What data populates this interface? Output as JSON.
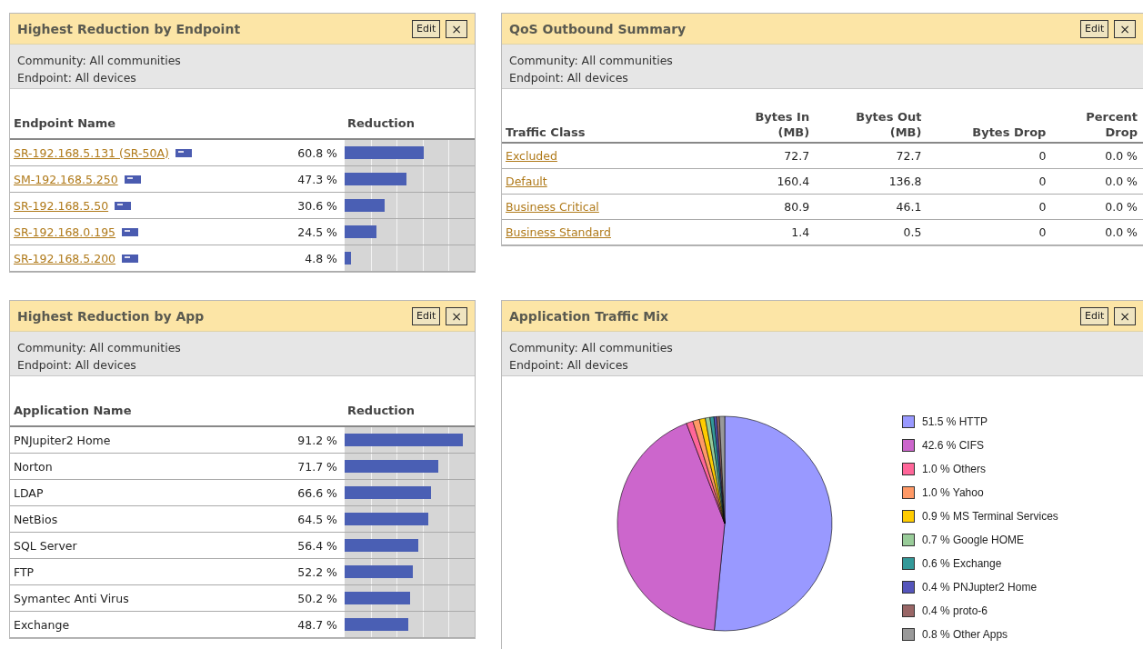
{
  "panels": [
    {
      "kind": "endpoint_reduction",
      "title": "Highest Reduction by Endpoint",
      "edit_button": "Edit",
      "close_button": "×",
      "filters": [
        "Community: All communities",
        "Endpoint: All devices"
      ],
      "columns": [
        "Endpoint Name",
        "Reduction"
      ],
      "rows": [
        {
          "name": "SR-192.168.5.131 (SR-50A)",
          "reduction": "60.8 %",
          "level": 0.608
        },
        {
          "name": "SM-192.168.5.250",
          "reduction": "47.3 %",
          "level": 0.473
        },
        {
          "name": "SR-192.168.5.50",
          "reduction": "30.6 %",
          "level": 0.306
        },
        {
          "name": "SR-192.168.0.195",
          "reduction": "24.5 %",
          "level": 0.245
        },
        {
          "name": "SR-192.168.5.200",
          "reduction": "4.8 %",
          "level": 0.048
        }
      ]
    },
    {
      "kind": "qos",
      "title": "QoS Outbound Summary",
      "edit_button": "Edit",
      "close_button": "×",
      "filters": [
        "Community: All communities",
        "Endpoint: All devices"
      ],
      "columns": [
        "Traffic Class",
        "Bytes In\n(MB)",
        "Bytes Out\n(MB)",
        "Bytes Drop",
        "Percent\nDrop"
      ],
      "rows": [
        [
          "Excluded",
          "72.7",
          "72.7",
          "0",
          "0.0 %"
        ],
        [
          "Default",
          "160.4",
          "136.8",
          "0",
          "0.0 %"
        ],
        [
          "Business Critical",
          "80.9",
          "46.1",
          "0",
          "0.0 %"
        ],
        [
          "Business Standard",
          "1.4",
          "0.5",
          "0",
          "0.0 %"
        ]
      ]
    },
    {
      "kind": "app_reduction",
      "title": "Highest Reduction by App",
      "edit_button": "Edit",
      "close_button": "×",
      "filters": [
        "Community: All communities",
        "Endpoint: All devices"
      ],
      "columns": [
        "Application Name",
        "Reduction"
      ],
      "rows": [
        {
          "name": "PNJupiter2 Home",
          "reduction": "91.2 %",
          "level": 0.912
        },
        {
          "name": "Norton",
          "reduction": "71.7 %",
          "level": 0.717
        },
        {
          "name": "LDAP",
          "reduction": "66.6 %",
          "level": 0.666
        },
        {
          "name": "NetBios",
          "reduction": "64.5 %",
          "level": 0.645
        },
        {
          "name": "SQL Server",
          "reduction": "56.4 %",
          "level": 0.564
        },
        {
          "name": "FTP",
          "reduction": "52.2 %",
          "level": 0.522
        },
        {
          "name": "Symantec Anti Virus",
          "reduction": "50.2 %",
          "level": 0.502
        },
        {
          "name": "Exchange",
          "reduction": "48.7 %",
          "level": 0.487
        }
      ]
    },
    {
      "kind": "pie",
      "title": "Application Traffic Mix",
      "edit_button": "Edit",
      "close_button": "×",
      "filters": [
        "Community: All communities",
        "Endpoint: All devices"
      ],
      "chart_data": {
        "type": "pie",
        "categories": [
          "HTTP",
          "CIFS",
          "Others",
          "Yahoo",
          "MS Terminal Services",
          "Google HOME",
          "Exchange",
          "PNJupter2 Home",
          "proto-6",
          "Other Apps"
        ],
        "values": [
          51.5,
          42.6,
          1.0,
          1.0,
          0.9,
          0.7,
          0.6,
          0.4,
          0.4,
          0.8
        ]
      },
      "legend": [
        {
          "percent": "51.5 %",
          "color": "#9999ff"
        },
        {
          "percent": "42.6 %",
          "color": "#cc66cc"
        },
        {
          "percent": "1.0 %",
          "color": "#ff6699"
        },
        {
          "percent": "1.0 %",
          "color": "#ff9966"
        },
        {
          "percent": "0.9 %",
          "color": "#ffcc00"
        },
        {
          "percent": "0.7 %",
          "color": "#99cc99"
        },
        {
          "percent": "0.6 %",
          "color": "#339999"
        },
        {
          "percent": "0.4 %",
          "color": "#5555bb"
        },
        {
          "percent": "0.4 %",
          "color": "#996666"
        },
        {
          "percent": "0.8 %",
          "color": "#999999"
        }
      ]
    }
  ]
}
